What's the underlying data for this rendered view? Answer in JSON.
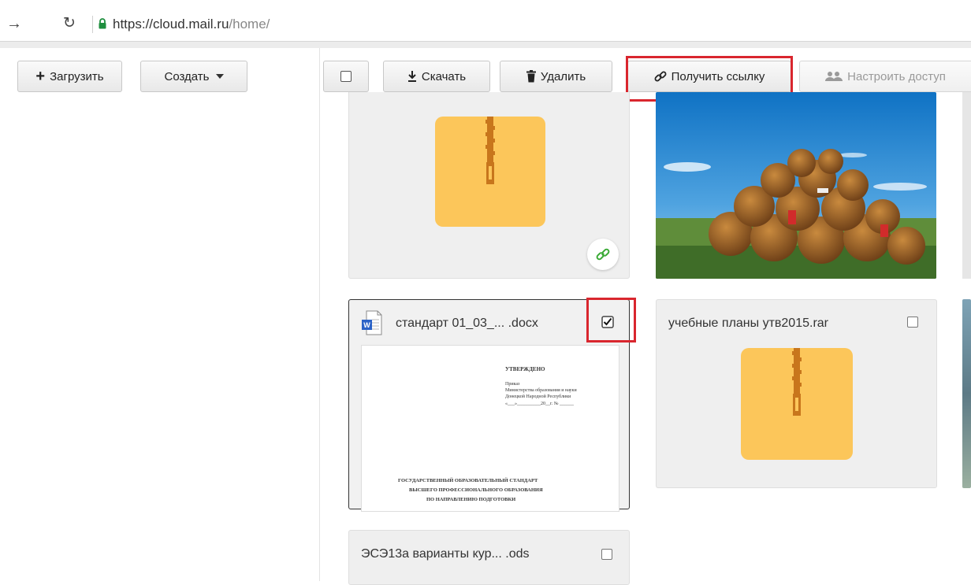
{
  "browser": {
    "url_host": "https://cloud.mail.ru",
    "url_path": "/home/"
  },
  "toolbar": {
    "upload_label": "Загрузить",
    "create_label": "Создать",
    "download_label": "Скачать",
    "delete_label": "Удалить",
    "get_link_label": "Получить ссылку",
    "access_label": "Настроить доступ"
  },
  "files": [
    {
      "name": "стандарт 01_03_... .docx",
      "checked": true
    },
    {
      "name": "учебные планы утв2015.rar",
      "checked": false
    },
    {
      "name": "ЭСЭ13а варианты кур... .ods",
      "checked": false
    }
  ],
  "doc_preview": {
    "approved": "УТВЕРЖДЕНО",
    "order": "Приказ",
    "ministry_line1": "Министерства образования и науки",
    "ministry_line2": "Донецкой Народной Республики",
    "date_line": "«___»__________20__г. № ______",
    "heading1": "ГОСУДАРСТВЕННЫЙ ОБРАЗОВАТЕЛЬНЫЙ СТАНДАРТ",
    "heading2": "ВЫСШЕГО ПРОФЕССИОНАЛЬНОГО ОБРАЗОВАНИЯ",
    "heading3": "ПО НАПРАВЛЕНИЮ ПОДГОТОВКИ"
  },
  "colors": {
    "accent_red": "#d9262e",
    "zip_yellow": "#fcc65a",
    "zip_brown": "#c8761c",
    "link_green": "#3aaa35"
  }
}
